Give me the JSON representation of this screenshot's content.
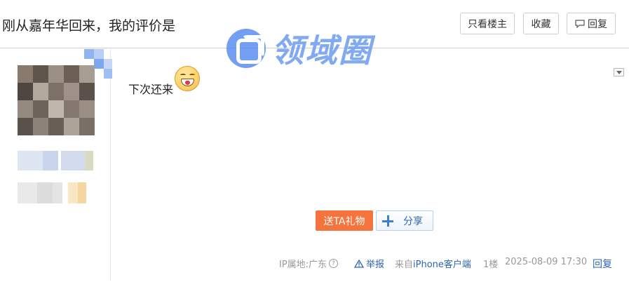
{
  "header": {
    "title": "刚从嘉年华回来，我的评价是",
    "only_op_label": "只看楼主",
    "favorite_label": "收藏",
    "reply_label": "回复"
  },
  "watermark": {
    "text": "领域圈"
  },
  "post": {
    "content": "下次还来",
    "emoji_icon": "grin-heart-emoji",
    "gift_button": "送TA礼物",
    "share_button": "分享",
    "ip_label": "IP属地:广东",
    "report_label": "举报",
    "from_prefix": "来自",
    "from_device": "iPhone客户端",
    "floor": "1楼",
    "time": "2025-08-09 17:30",
    "reply_link": "回复"
  },
  "colors": {
    "accent_blue": "#2d64b3",
    "gift_orange": "#f5733c",
    "watermark_blue": "#5b8ff0"
  }
}
